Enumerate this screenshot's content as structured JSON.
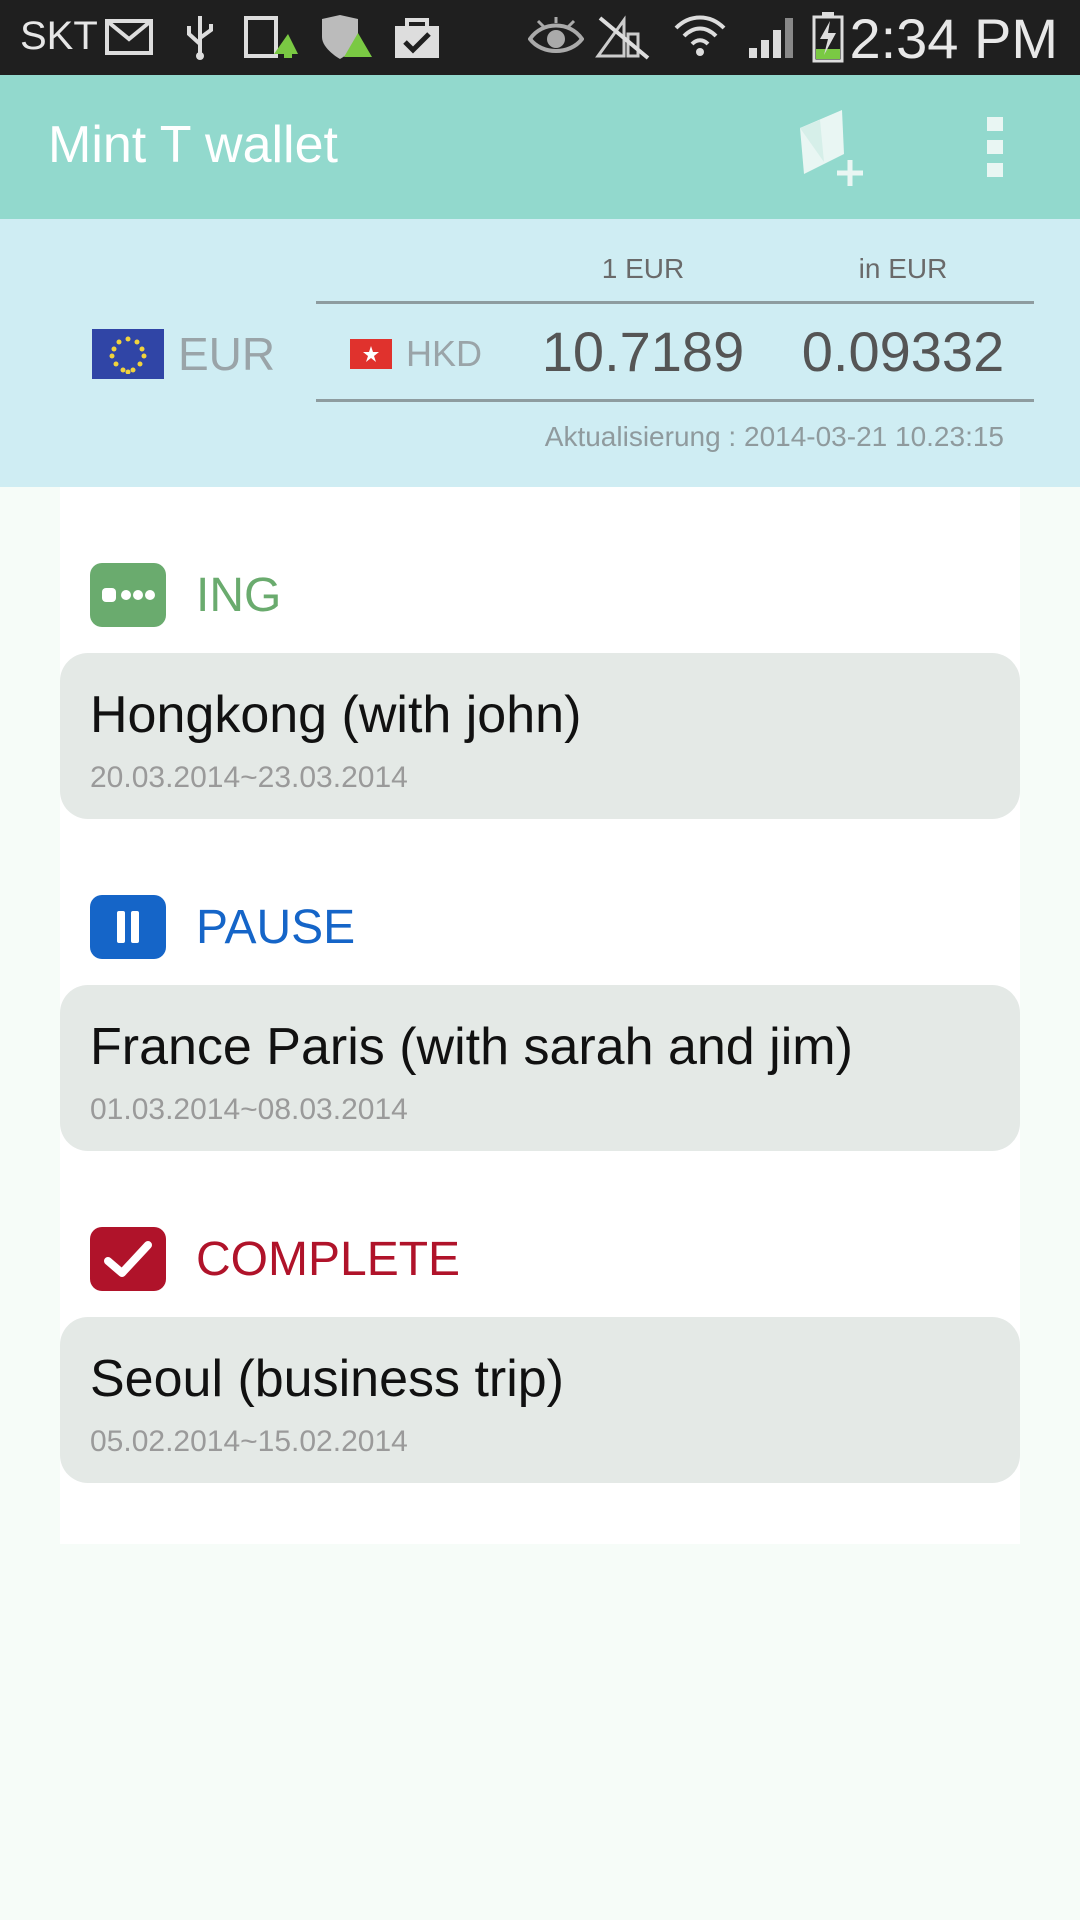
{
  "status_bar": {
    "carrier": "SKT",
    "time": "2:34 PM",
    "icons": [
      "mail-icon",
      "usb-icon",
      "upload-icon",
      "shield-update-icon",
      "bag-check-icon",
      "eye-icon",
      "no-signal-icon",
      "wifi-icon",
      "cell-signal-icon",
      "battery-charging-icon"
    ]
  },
  "app_bar": {
    "title": "Mint T wallet",
    "add_trip_icon": "add-trip-icon",
    "overflow_icon": "overflow-menu-icon",
    "background_color": "#92d9cd"
  },
  "currency": {
    "base_code": "EUR",
    "target_code": "HKD",
    "col1_header": "1 EUR",
    "col2_header": "in EUR",
    "rate1": "10.7189",
    "rate2": "0.09332",
    "update_text": "Aktualisierung : 2014-03-21 10.23:15"
  },
  "sections": [
    {
      "label": "ING",
      "color": "#6aab6e",
      "icon": "in-progress-icon",
      "trip": {
        "name": "Hongkong (with john)",
        "dates": "20.03.2014~23.03.2014"
      }
    },
    {
      "label": "PAUSE",
      "color": "#1565c8",
      "icon": "pause-icon",
      "trip": {
        "name": "France Paris (with sarah and jim)",
        "dates": "01.03.2014~08.03.2014"
      }
    },
    {
      "label": "COMPLETE",
      "color": "#b0132a",
      "icon": "complete-check-icon",
      "trip": {
        "name": "Seoul (business trip)",
        "dates": "05.02.2014~15.02.2014"
      }
    }
  ]
}
